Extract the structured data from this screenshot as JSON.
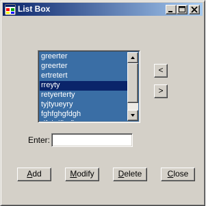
{
  "window": {
    "title": "List Box",
    "icon": "app-window-icon",
    "controls": {
      "minimize_icon": "minimize-icon",
      "maximize_icon": "maximize-icon",
      "close_icon": "close-icon"
    }
  },
  "listbox": {
    "items": [
      "greerter",
      "greerter",
      "ertretert",
      "rreyty",
      "retyerterty",
      "tyjtyueyry",
      "fghfghgfdgh",
      "dfghdfhgfh"
    ],
    "selected_index": 3,
    "highlight_color": "#3a6ea5",
    "selected_color": "#0a246a"
  },
  "move_buttons": {
    "left_label": "<",
    "right_label": ">"
  },
  "form": {
    "enter_label": "Enter:",
    "enter_value": ""
  },
  "buttons": {
    "add": {
      "accel": "A",
      "rest": "dd"
    },
    "modify": {
      "accel": "M",
      "rest": "odify"
    },
    "delete": {
      "accel": "D",
      "rest": "elete"
    },
    "close": {
      "accel": "C",
      "rest": "lose"
    }
  }
}
